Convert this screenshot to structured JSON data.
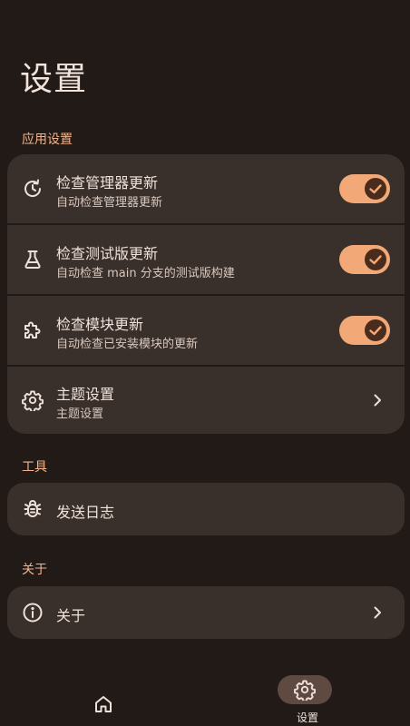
{
  "page": {
    "title": "设置"
  },
  "sections": {
    "app": {
      "header": "应用设置",
      "items": [
        {
          "title": "检查管理器更新",
          "subtitle": "自动检查管理器更新",
          "icon": "update-icon",
          "toggle_on": true
        },
        {
          "title": "检查测试版更新",
          "subtitle": "自动检查 main 分支的测试版构建",
          "icon": "flask-icon",
          "toggle_on": true
        },
        {
          "title": "检查模块更新",
          "subtitle": "自动检查已安装模块的更新",
          "icon": "extension-icon",
          "toggle_on": true
        },
        {
          "title": "主题设置",
          "subtitle": "主题设置",
          "icon": "gear-icon"
        }
      ]
    },
    "tools": {
      "header": "工具",
      "items": [
        {
          "title": "发送日志",
          "icon": "bug-icon"
        }
      ]
    },
    "about": {
      "header": "关于",
      "items": [
        {
          "title": "关于",
          "icon": "info-icon"
        }
      ]
    }
  },
  "bottom_nav": {
    "items": [
      {
        "label": "",
        "icon": "home-icon",
        "active": false
      },
      {
        "label": "设置",
        "icon": "gear-icon",
        "active": true
      }
    ]
  },
  "colors": {
    "background": "#221a16",
    "card": "#3a302b",
    "accent": "#f3a878",
    "accent_text": "#f3b48c",
    "switch_thumb": "#4a2c1c",
    "nav_active_pill": "#5e4a40"
  }
}
